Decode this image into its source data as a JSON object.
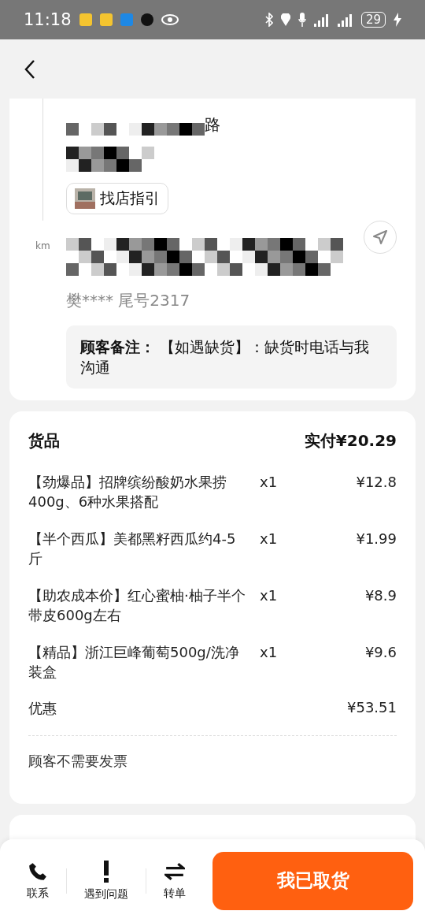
{
  "status_bar": {
    "time": "11:18",
    "battery": "29"
  },
  "pickup": {
    "address_tail": "路",
    "distance_unit": "km",
    "guide_button": "找店指引",
    "customer": "樊**** 尾号2317",
    "note_label": "顾客备注：",
    "note_text": "【如遇缺货】：缺货时电话与我沟通"
  },
  "goods": {
    "title": "货品",
    "paid": "实付¥20.29",
    "items": [
      {
        "name": "【劲爆品】招牌缤纷酸奶水果捞400g、6种水果搭配",
        "qty": "x1",
        "price": "¥12.8"
      },
      {
        "name": "【半个西瓜】美都黑籽西瓜约4-5斤",
        "qty": "x1",
        "price": "¥1.99"
      },
      {
        "name": "【助农成本价】红心蜜柚·柚子半个带皮600g左右",
        "qty": "x1",
        "price": "¥8.9"
      },
      {
        "name": "【精品】浙江巨峰葡萄500g/洗净装盒",
        "qty": "x1",
        "price": "¥9.6"
      }
    ],
    "discount_label": "优惠",
    "discount": "¥53.51",
    "invoice": "顾客不需要发票"
  },
  "actions": [
    {
      "kind": "phone",
      "label": "联系"
    },
    {
      "kind": "alert",
      "label": "遇到问题"
    },
    {
      "kind": "transfer",
      "label": "转单"
    }
  ],
  "primary_button": "我已取货"
}
